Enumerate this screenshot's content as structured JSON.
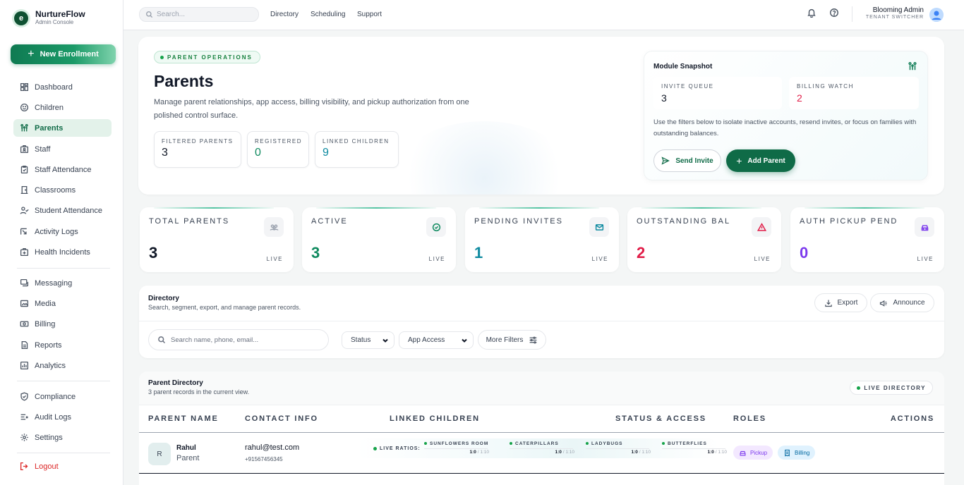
{
  "brand": {
    "name": "NurtureFlow",
    "sub": "Admin Console"
  },
  "sidebar": {
    "new_button": "New Enrollment",
    "items": [
      {
        "label": "Dashboard",
        "icon": "grid-icon"
      },
      {
        "label": "Children",
        "icon": "smile-icon"
      },
      {
        "label": "Parents",
        "icon": "family-icon",
        "active": true
      },
      {
        "label": "Staff",
        "icon": "badge-icon"
      },
      {
        "label": "Staff Attendance",
        "icon": "clipboard-icon"
      },
      {
        "label": "Classrooms",
        "icon": "door-icon"
      },
      {
        "label": "Student Attendance",
        "icon": "user-check-icon"
      },
      {
        "label": "Activity Logs",
        "icon": "activity-icon"
      },
      {
        "label": "Health Incidents",
        "icon": "medical-icon"
      },
      {
        "label": "Messaging",
        "icon": "message-icon"
      },
      {
        "label": "Media",
        "icon": "image-icon"
      },
      {
        "label": "Billing",
        "icon": "money-icon"
      },
      {
        "label": "Reports",
        "icon": "document-icon"
      },
      {
        "label": "Analytics",
        "icon": "chart-icon"
      },
      {
        "label": "Compliance",
        "icon": "shield-icon"
      },
      {
        "label": "Audit Logs",
        "icon": "audit-icon"
      },
      {
        "label": "Settings",
        "icon": "gear-icon"
      }
    ],
    "logout": "Logout"
  },
  "topbar": {
    "search_placeholder": "Search...",
    "links": [
      "Directory",
      "Scheduling",
      "Support"
    ],
    "user_name": "Blooming Admin",
    "user_role": "TENANT SWITCHER"
  },
  "hero": {
    "badge": "PARENT OPERATIONS",
    "title": "Parents",
    "description": "Manage parent relationships, app access, billing visibility, and pickup authorization from one polished control surface.",
    "stats": [
      {
        "label": "FILTERED PARENTS",
        "value": "3",
        "color": "#111827"
      },
      {
        "label": "REGISTERED",
        "value": "0",
        "color": "#0f8a5f"
      },
      {
        "label": "LINKED CHILDREN",
        "value": "9",
        "color": "#0e8aa0"
      }
    ]
  },
  "snapshot": {
    "title": "Module Snapshot",
    "invite_label": "INVITE QUEUE",
    "invite_value": "3",
    "billing_label": "BILLING WATCH",
    "billing_value": "2",
    "description": "Use the filters below to isolate inactive accounts, resend invites, or focus on families with outstanding balances.",
    "send_invite": "Send Invite",
    "add_parent": "Add Parent"
  },
  "kpis": [
    {
      "label": "TOTAL PARENTS",
      "value": "3",
      "live": "LIVE",
      "color": "#111827",
      "icon": "users-icon",
      "icon_color": "#9ca3af"
    },
    {
      "label": "ACTIVE",
      "value": "3",
      "live": "LIVE",
      "color": "#0f8a5f",
      "icon": "check-circle-icon",
      "icon_color": "#0f8a5f"
    },
    {
      "label": "PENDING INVITES",
      "value": "1",
      "live": "LIVE",
      "color": "#0e8aa0",
      "icon": "mail-icon",
      "icon_color": "#0e8aa0"
    },
    {
      "label": "OUTSTANDING BAL",
      "value": "2",
      "live": "LIVE",
      "color": "#e11d48",
      "icon": "warning-icon",
      "icon_color": "#e11d48"
    },
    {
      "label": "AUTH PICKUP PEND",
      "value": "0",
      "live": "LIVE",
      "color": "#7c3aed",
      "icon": "car-icon",
      "icon_color": "#7c3aed"
    }
  ],
  "directory": {
    "title": "Directory",
    "subtitle": "Search, segment, export, and manage parent records.",
    "export": "Export",
    "announce": "Announce",
    "search_placeholder": "Search name, phone, email...",
    "status": "Status",
    "app_access": "App Access",
    "more_filters": "More Filters"
  },
  "table": {
    "title": "Parent Directory",
    "subtitle": "3 parent records in the current view.",
    "live_badge": "LIVE DIRECTORY",
    "columns": [
      "PARENT NAME",
      "CONTACT INFO",
      "LINKED CHILDREN",
      "STATUS & ACCESS",
      "ROLES",
      "ACTIONS"
    ],
    "rows": [
      {
        "initial": "R",
        "name": "Rahul",
        "role": "Parent",
        "email": "rahul@test.com",
        "phone": "+91567456345",
        "ratios_label": "LIVE RATIOS:",
        "rooms": [
          {
            "name": "SUNFLOWERS ROOM",
            "current": "1:0",
            "limit": "/ 1:10"
          },
          {
            "name": "CATERPILLARS",
            "current": "1:0",
            "limit": "/ 1:10"
          },
          {
            "name": "LADYBUGS",
            "current": "1:0",
            "limit": "/ 1:10"
          },
          {
            "name": "BUTTERFLIES",
            "current": "1:0",
            "limit": "/ 1:10"
          }
        ],
        "roles": [
          "Pickup",
          "Billing"
        ]
      }
    ]
  }
}
